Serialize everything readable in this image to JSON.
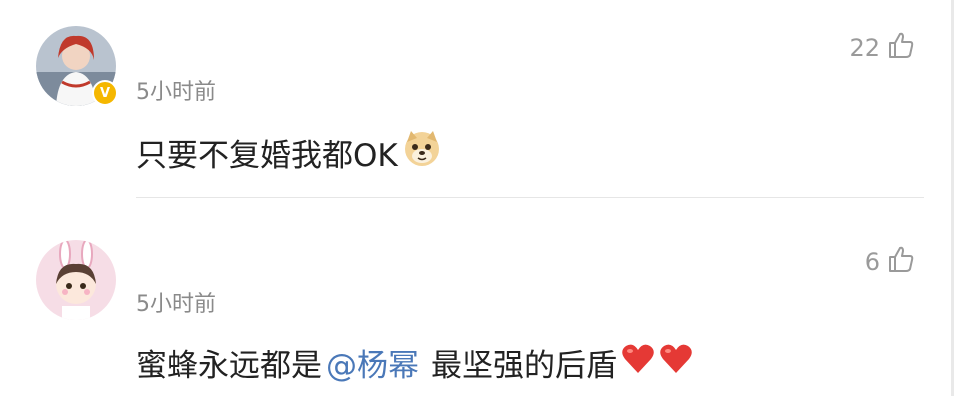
{
  "comments": [
    {
      "timestamp": "5小时前",
      "text": "只要不复婚我都OK",
      "emoji": "doge-emoji",
      "like_count": "22",
      "verified": true
    },
    {
      "timestamp": "5小时前",
      "text_before": "蜜蜂永远都是",
      "mention": "@杨幂",
      "text_after": "最坚强的后盾",
      "emoji": "red-heart-emoji",
      "like_count": "6",
      "verified": false
    }
  ],
  "icons": {
    "like": "thumbs-up-icon",
    "verified": "verified-badge-icon"
  },
  "colors": {
    "timestamp": "#8a8a8a",
    "mention": "#4a78b8",
    "verified_badge": "#f5b700",
    "heart": "#e53935"
  }
}
